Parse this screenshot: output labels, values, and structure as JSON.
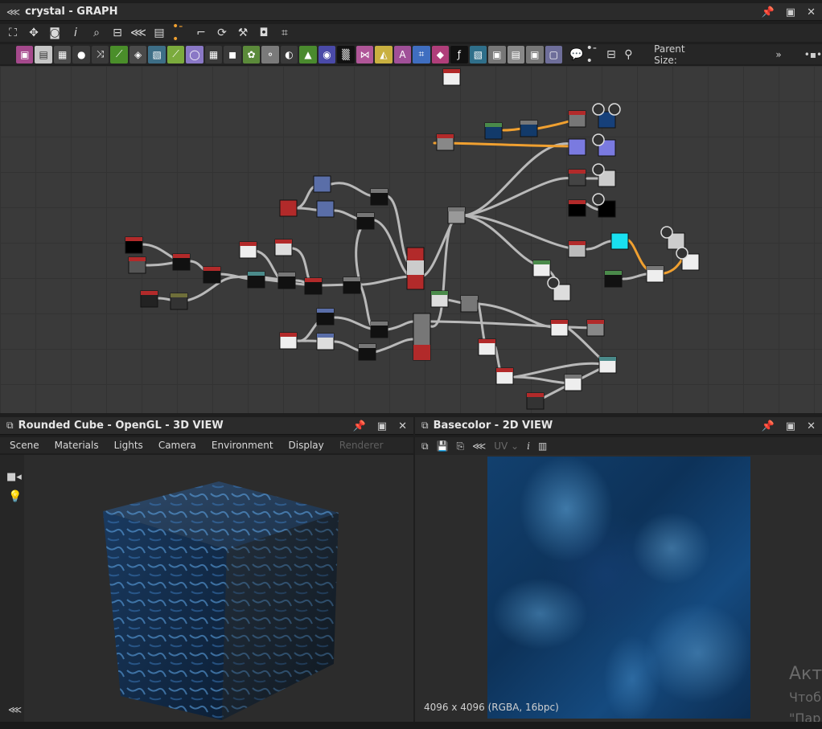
{
  "graph_window": {
    "title": "crystal - GRAPH"
  },
  "toolbar2": {
    "parent_size_label": "Parent Size:"
  },
  "view3d": {
    "title": "Rounded Cube - OpenGL - 3D VIEW",
    "menu": [
      "Scene",
      "Materials",
      "Lights",
      "Camera",
      "Environment",
      "Display",
      "Renderer"
    ]
  },
  "view2d": {
    "title": "Basecolor - 2D VIEW",
    "uv_label": "UV",
    "resolution": "4096 x 4096 (RGBA, 16bpc)"
  },
  "watermark": {
    "line1": "Акти",
    "line2": "Чтоб",
    "line3": "\"Пар"
  },
  "colors": {
    "accent_orange": "#f0a030",
    "node_red": "#b22a2a",
    "node_blue": "#5a6ea8",
    "cyan": "#19e0f0"
  },
  "icons": {
    "toolbar1": [
      "frame-all-icon",
      "center-icon",
      "camera-icon",
      "info-icon",
      "search-icon",
      "link-icon",
      "tree-icon",
      "layers-icon",
      "connection-icon",
      "route-icon",
      "refresh-icon",
      "wrench-icon",
      "screen-icon",
      "crop-icon"
    ],
    "toolbar2": [
      "image-icon",
      "bitmap-icon",
      "gradient-icon",
      "drop-icon",
      "shuffle-icon",
      "curve-icon",
      "blend-icon",
      "normal-icon",
      "level-icon",
      "circle-icon",
      "grid-icon",
      "fill-icon",
      "watering-icon",
      "node-icon",
      "split-icon",
      "histogram-icon",
      "color-wheel-icon",
      "noise-icon",
      "transform-icon",
      "mirror-icon",
      "text-icon",
      "crop-icon",
      "paint-bucket-icon",
      "fx-icon",
      "warp-icon",
      "output-icon",
      "input-icon",
      "comment-icon",
      "dot-icon",
      "pin-icon"
    ]
  }
}
